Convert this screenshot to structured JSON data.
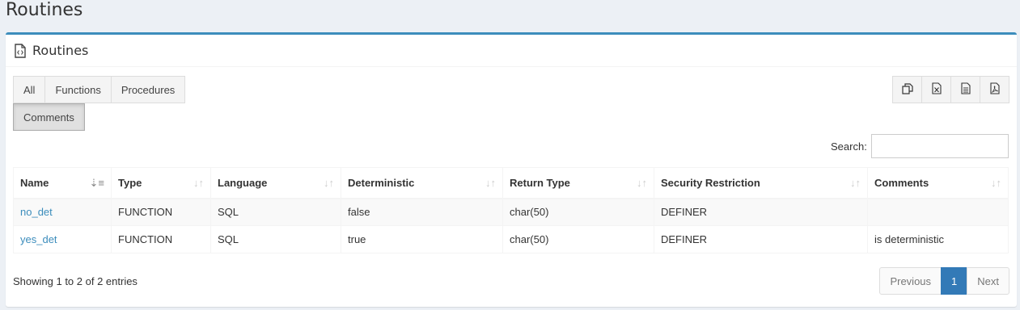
{
  "page": {
    "title": "Routines"
  },
  "box": {
    "title": "Routines",
    "icon": "code-file-icon"
  },
  "tabs": [
    {
      "label": "All"
    },
    {
      "label": "Functions"
    },
    {
      "label": "Procedures"
    }
  ],
  "comments_toggle": {
    "label": "Comments",
    "active": true
  },
  "export_buttons": [
    {
      "icon": "copy-icon"
    },
    {
      "icon": "excel-icon"
    },
    {
      "icon": "csv-icon"
    },
    {
      "icon": "pdf-icon"
    }
  ],
  "search": {
    "label": "Search:",
    "value": ""
  },
  "table": {
    "columns": [
      "Name",
      "Type",
      "Language",
      "Deterministic",
      "Return Type",
      "Security Restriction",
      "Comments"
    ],
    "rows": [
      {
        "name": "no_det",
        "type": "FUNCTION",
        "language": "SQL",
        "deterministic": "false",
        "return_type": "char(50)",
        "security": "DEFINER",
        "comments": ""
      },
      {
        "name": "yes_det",
        "type": "FUNCTION",
        "language": "SQL",
        "deterministic": "true",
        "return_type": "char(50)",
        "security": "DEFINER",
        "comments": "is deterministic"
      }
    ]
  },
  "footer": {
    "info": "Showing 1 to 2 of 2 entries",
    "previous": "Previous",
    "current_page": "1",
    "next": "Next"
  },
  "colors": {
    "accent": "#3c8dbc",
    "page_bg": "#ecf0f5",
    "active_page": "#337ab7"
  }
}
